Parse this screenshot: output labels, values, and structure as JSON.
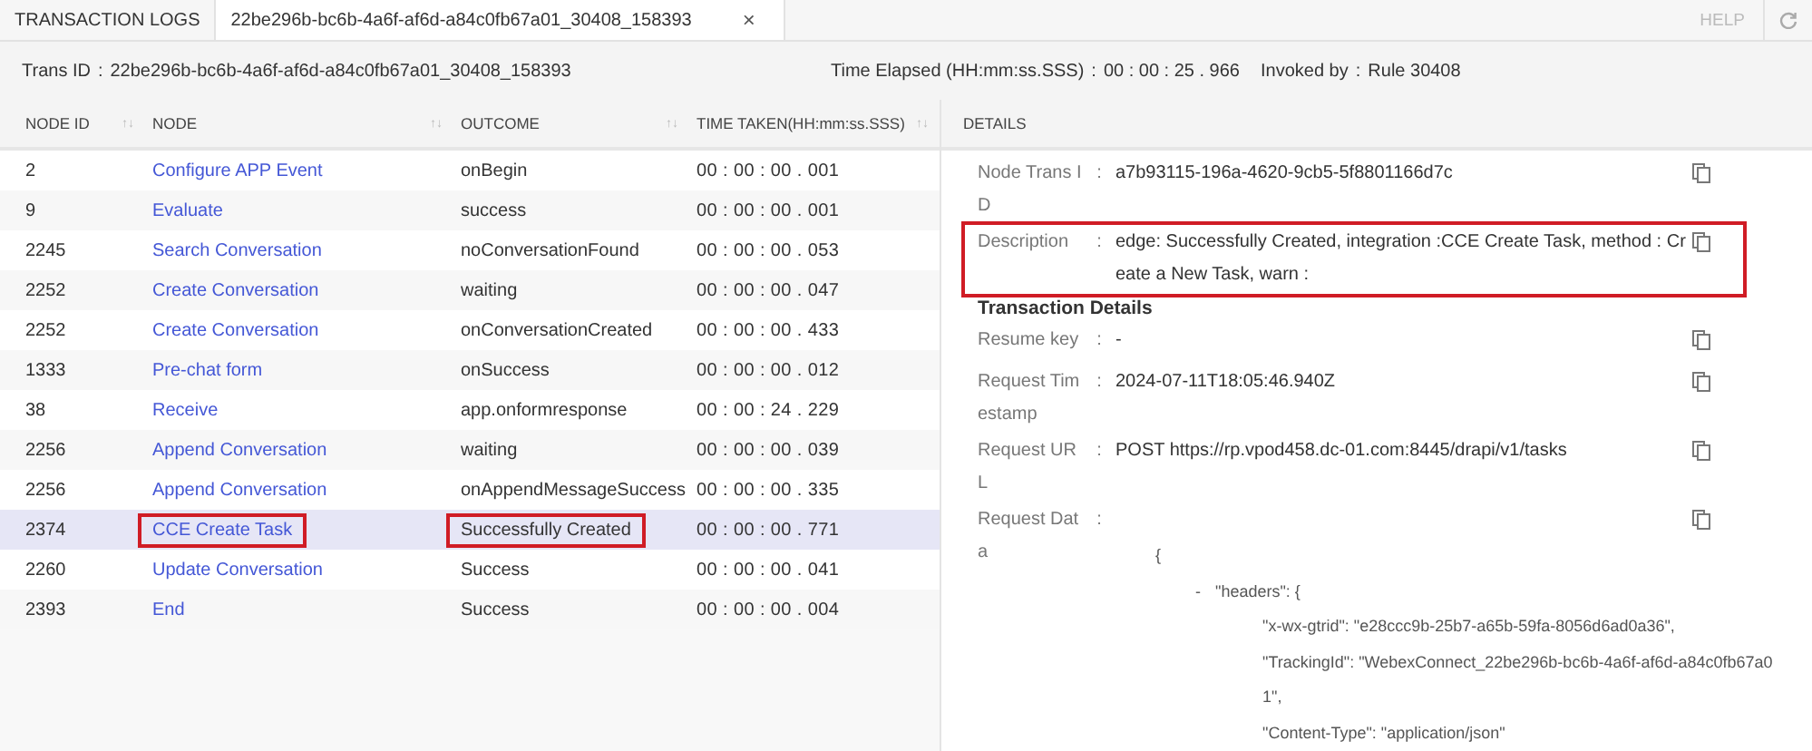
{
  "tabs": [
    {
      "label": "TRANSACTION LOGS",
      "selected": false,
      "closable": false
    },
    {
      "label": "22be296b-bc6b-4a6f-af6d-a84c0fb67a01_30408_158393",
      "selected": true,
      "closable": true,
      "close_glyph": "×"
    }
  ],
  "toolbar": {
    "help": "HELP",
    "help_disabled": true
  },
  "info": [
    {
      "label": "Trans ID",
      "separator": ":",
      "value": "22be296b-bc6b-4a6f-af6d-a84c0fb67a01_30408_158393"
    },
    {
      "label": "Time Elapsed (HH:mm:ss.SSS)",
      "separator": ":",
      "value": "00 : 00 : 25 . 966"
    },
    {
      "label": "Invoked by",
      "separator": ":",
      "value": "Rule 30408"
    }
  ],
  "table": {
    "columns": [
      {
        "label": "NODE ID",
        "sort_glyph": "↑↓"
      },
      {
        "label": "NODE",
        "sort_glyph": "↑↓"
      },
      {
        "label": "OUTCOME",
        "sort_glyph": "↑↓"
      },
      {
        "label": "TIME TAKEN(HH:mm:ss.SSS)",
        "sort_glyph": "↑↓"
      }
    ],
    "rows": [
      {
        "node_id": "2",
        "node": "Configure APP Event",
        "outcome": "onBegin",
        "time": "00 : 00 : 00 . 001",
        "selected": false,
        "highlighted": false
      },
      {
        "node_id": "9",
        "node": "Evaluate",
        "outcome": "success",
        "time": "00 : 00 : 00 . 001",
        "selected": false,
        "highlighted": false
      },
      {
        "node_id": "2245",
        "node": "Search Conversation",
        "outcome": "noConversationFound",
        "time": "00 : 00 : 00 . 053",
        "selected": false,
        "highlighted": false
      },
      {
        "node_id": "2252",
        "node": "Create Conversation",
        "outcome": "waiting",
        "time": "00 : 00 : 00 . 047",
        "selected": false,
        "highlighted": false
      },
      {
        "node_id": "2252",
        "node": "Create Conversation",
        "outcome": "onConversationCreated",
        "time": "00 : 00 : 00 . 433",
        "selected": false,
        "highlighted": false
      },
      {
        "node_id": "1333",
        "node": "Pre-chat form",
        "outcome": "onSuccess",
        "time": "00 : 00 : 00 . 012",
        "selected": false,
        "highlighted": false
      },
      {
        "node_id": "38",
        "node": "Receive",
        "outcome": "app.onformresponse",
        "time": "00 : 00 : 24 . 229",
        "selected": false,
        "highlighted": false
      },
      {
        "node_id": "2256",
        "node": "Append Conversation",
        "outcome": "waiting",
        "time": "00 : 00 : 00 . 039",
        "selected": false,
        "highlighted": false
      },
      {
        "node_id": "2256",
        "node": "Append Conversation",
        "outcome": "onAppendMessageSuccess",
        "time": "00 : 00 : 00 . 335",
        "selected": false,
        "highlighted": false
      },
      {
        "node_id": "2374",
        "node": "CCE Create Task",
        "outcome": "Successfully Created",
        "time": "00 : 00 : 00 . 771",
        "selected": true,
        "highlighted": true
      },
      {
        "node_id": "2260",
        "node": "Update Conversation",
        "outcome": "Success",
        "time": "00 : 00 : 00 . 041",
        "selected": false,
        "highlighted": false
      },
      {
        "node_id": "2393",
        "node": "End",
        "outcome": "Success",
        "time": "00 : 00 : 00 . 004",
        "selected": false,
        "highlighted": false
      }
    ]
  },
  "details": {
    "title": "DETAILS",
    "fields": [
      {
        "label": "Node Trans ID",
        "separator": ":",
        "value": "a7b93115-196a-4620-9cb5-5f8801166d7c",
        "highlighted": false
      },
      {
        "label": "Description",
        "separator": ":",
        "value": "edge: Successfully Created, integration :CCE Create Task, method : Create a New Task, warn :",
        "highlighted": true
      }
    ],
    "section_title": "Transaction Details",
    "transaction_fields": [
      {
        "label": "Resume key",
        "separator": ":",
        "value": "-"
      },
      {
        "label": "Request Timestamp",
        "separator": ":",
        "value": "2024-07-11T18:05:46.940Z"
      },
      {
        "label": "Request URL",
        "separator": ":",
        "value": "POST https://rp.vpod458.dc-01.com:8445/drapi/v1/tasks"
      },
      {
        "label": "Request Data",
        "separator": ":"
      }
    ],
    "request_data": [
      {
        "text": "{",
        "children": [
          {
            "text": "\"headers\": {",
            "toggle": "-",
            "children": [
              {
                "text": "\"x-wx-gtrid\": \"e28ccc9b-25b7-a65b-59fa-8056d6ad0a36\","
              },
              {
                "text": "\"TrackingId\": \"WebexConnect_22be296b-bc6b-4a6f-af6d-a84c0fb67a01\","
              },
              {
                "text": "\"Content-Type\": \"application/json\""
              }
            ]
          }
        ]
      }
    ]
  }
}
